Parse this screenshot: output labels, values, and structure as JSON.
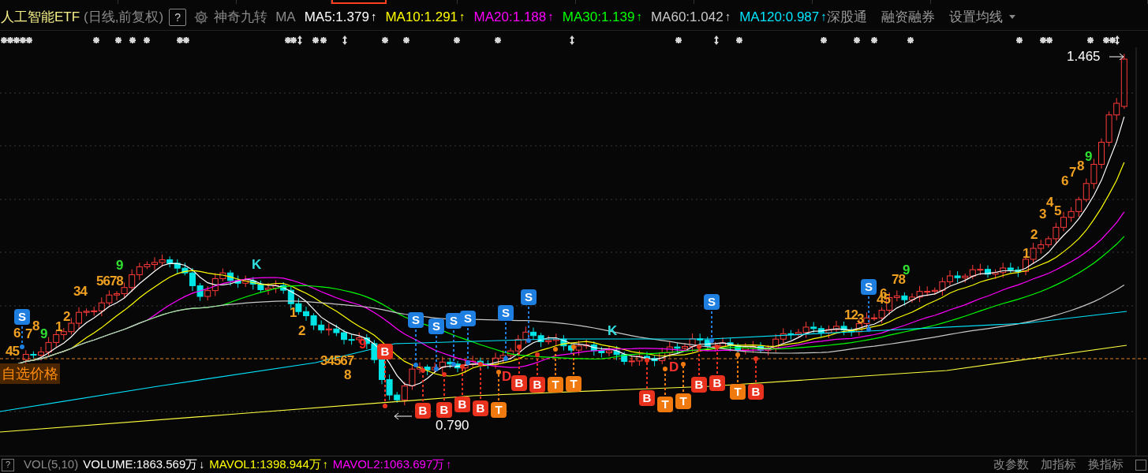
{
  "top_tabs": [
    {
      "selected": false
    },
    {
      "selected": false
    },
    {
      "selected": false
    },
    {
      "selected": true
    },
    {
      "selected": false
    },
    {
      "selected": false
    },
    {
      "selected": false
    },
    {
      "selected": false
    },
    {
      "selected": false
    },
    {
      "selected": false
    }
  ],
  "header": {
    "title": "人工智能ETF",
    "period": "(日线,前复权)",
    "help": "?",
    "indicator": "神奇九转",
    "ma_label": "MA",
    "ma_values": [
      {
        "text": "MA5:1.379",
        "arrow": "↑",
        "color": "#ffffff"
      },
      {
        "text": "MA10:1.291",
        "arrow": "↑",
        "color": "#ffff00"
      },
      {
        "text": "MA20:1.188",
        "arrow": "↑",
        "color": "#ff00ff"
      },
      {
        "text": "MA30:1.139",
        "arrow": "↑",
        "color": "#00ff00"
      },
      {
        "text": "MA60:1.042",
        "arrow": "↑",
        "color": "#c8c8c8"
      },
      {
        "text": "MA120:0.987",
        "arrow": "↑",
        "color": "#00e5ff"
      }
    ],
    "links": [
      "深股通",
      "融资融券",
      "设置均线"
    ]
  },
  "chart": {
    "price_high": "1.465",
    "price_low": "0.790",
    "custom_price_label": "自选价格",
    "signals": [
      {
        "text": "S",
        "kind": "badge",
        "color": "#1e7fe0"
      },
      {
        "text": "S",
        "kind": "badge",
        "color": "#1e7fe0"
      },
      {
        "text": "S",
        "kind": "badge",
        "color": "#1e7fe0"
      },
      {
        "text": "S",
        "kind": "badge",
        "color": "#1e7fe0"
      },
      {
        "text": "S",
        "kind": "badge",
        "color": "#1e7fe0"
      },
      {
        "text": "S",
        "kind": "badge",
        "color": "#1e7fe0"
      },
      {
        "text": "S",
        "kind": "badge",
        "color": "#1e7fe0"
      },
      {
        "text": "S",
        "kind": "badge",
        "color": "#1e7fe0"
      },
      {
        "text": "S",
        "kind": "badge",
        "color": "#1e7fe0"
      },
      {
        "text": "B",
        "kind": "badge",
        "color": "#e8321e"
      },
      {
        "text": "B",
        "kind": "badge",
        "color": "#e8321e"
      },
      {
        "text": "B",
        "kind": "badge",
        "color": "#e8321e"
      },
      {
        "text": "B",
        "kind": "badge",
        "color": "#e8321e"
      },
      {
        "text": "B",
        "kind": "badge",
        "color": "#e8321e"
      },
      {
        "text": "B",
        "kind": "badge",
        "color": "#e8321e"
      },
      {
        "text": "B",
        "kind": "badge",
        "color": "#e8321e"
      },
      {
        "text": "B",
        "kind": "badge",
        "color": "#e8321e"
      },
      {
        "text": "B",
        "kind": "badge",
        "color": "#e8321e"
      },
      {
        "text": "B",
        "kind": "badge",
        "color": "#e8321e"
      },
      {
        "text": "B",
        "kind": "badge",
        "color": "#e8321e"
      },
      {
        "text": "T",
        "kind": "badge",
        "color": "#f07a10"
      },
      {
        "text": "T",
        "kind": "badge",
        "color": "#f07a10"
      },
      {
        "text": "T",
        "kind": "badge",
        "color": "#f07a10"
      },
      {
        "text": "T",
        "kind": "badge",
        "color": "#f07a10"
      },
      {
        "text": "T",
        "kind": "badge",
        "color": "#f07a10"
      },
      {
        "text": "T",
        "kind": "badge",
        "color": "#f07a10"
      },
      {
        "text": "6",
        "kind": "mark",
        "color": "#f0a020"
      },
      {
        "text": "45",
        "kind": "mark",
        "color": "#f0a020"
      },
      {
        "text": "7",
        "kind": "mark",
        "color": "#f0a020"
      },
      {
        "text": "8",
        "kind": "mark",
        "color": "#f0a020"
      },
      {
        "text": "9",
        "kind": "mark",
        "color": "#30e030"
      },
      {
        "text": "1",
        "kind": "mark",
        "color": "#f0a020"
      },
      {
        "text": "2",
        "kind": "mark",
        "color": "#f0a020"
      },
      {
        "text": "34",
        "kind": "mark",
        "color": "#f0a020"
      },
      {
        "text": "5678",
        "kind": "mark",
        "color": "#f0a020"
      },
      {
        "text": "9",
        "kind": "mark",
        "color": "#30e030"
      },
      {
        "text": "K",
        "kind": "mark",
        "color": "#30e0e0"
      },
      {
        "text": "1",
        "kind": "mark",
        "color": "#f0a020"
      },
      {
        "text": "2",
        "kind": "mark",
        "color": "#f0a020"
      },
      {
        "text": "34567",
        "kind": "mark",
        "color": "#f0a020"
      },
      {
        "text": "8",
        "kind": "mark",
        "color": "#f0a020"
      },
      {
        "text": "9",
        "kind": "mark",
        "color": "#ff2020"
      },
      {
        "text": "D",
        "kind": "mark",
        "color": "#ff3030"
      },
      {
        "text": "K",
        "kind": "mark",
        "color": "#30e0e0"
      },
      {
        "text": "D",
        "kind": "mark",
        "color": "#ff3030"
      },
      {
        "text": "12",
        "kind": "mark",
        "color": "#f0a020"
      },
      {
        "text": "3",
        "kind": "mark",
        "color": "#f0a020"
      },
      {
        "text": "45",
        "kind": "mark",
        "color": "#f0a020"
      },
      {
        "text": "6",
        "kind": "mark",
        "color": "#f0a020"
      },
      {
        "text": "78",
        "kind": "mark",
        "color": "#f0a020"
      },
      {
        "text": "9",
        "kind": "mark",
        "color": "#30e030"
      },
      {
        "text": "1",
        "kind": "mark",
        "color": "#f0a020"
      },
      {
        "text": "2",
        "kind": "mark",
        "color": "#f0a020"
      },
      {
        "text": "3",
        "kind": "mark",
        "color": "#f0a020"
      },
      {
        "text": "4",
        "kind": "mark",
        "color": "#f0a020"
      },
      {
        "text": "5",
        "kind": "mark",
        "color": "#f0a020"
      },
      {
        "text": "6",
        "kind": "mark",
        "color": "#f0a020"
      },
      {
        "text": "7",
        "kind": "mark",
        "color": "#f0a020"
      },
      {
        "text": "8",
        "kind": "mark",
        "color": "#f0a020"
      },
      {
        "text": "9",
        "kind": "mark",
        "color": "#30e030"
      }
    ]
  },
  "volume_bar": {
    "help": "?",
    "label": "VOL(5,10)",
    "values": [
      {
        "text": "VOLUME:1863.569万",
        "arrow": "↓",
        "color": "#ffffff"
      },
      {
        "text": "MAVOL1:1398.944万",
        "arrow": "↑",
        "color": "#ffff00"
      },
      {
        "text": "MAVOL2:1063.697万",
        "arrow": "↑",
        "color": "#ff00ff"
      }
    ],
    "buttons": [
      "改参数",
      "加指标",
      "换指标"
    ]
  }
}
